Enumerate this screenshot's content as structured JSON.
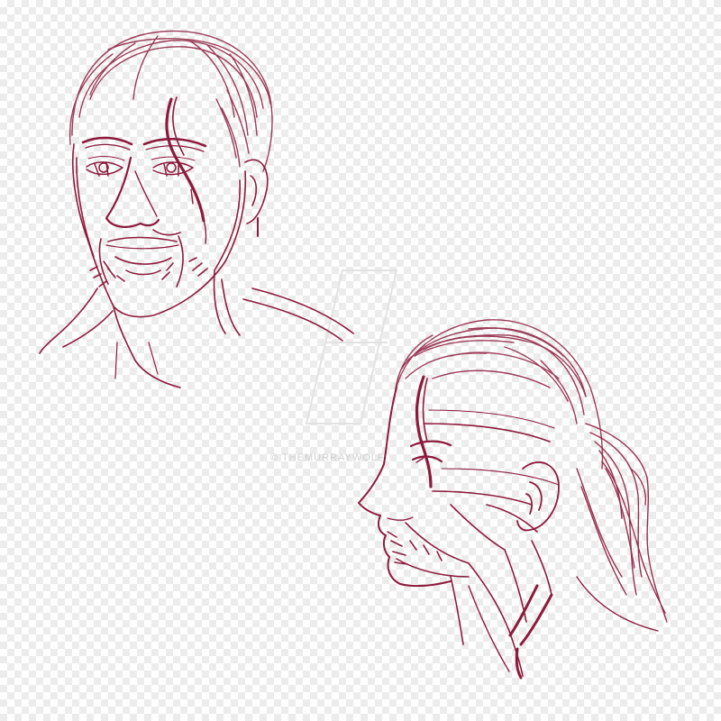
{
  "image": {
    "ink_color": "#8c1a3c",
    "watermark_text": "© THEMURRAYWOLF"
  },
  "icons": [
    "front-portrait-sketch",
    "profile-portrait-sketch",
    "watermark-logo"
  ]
}
